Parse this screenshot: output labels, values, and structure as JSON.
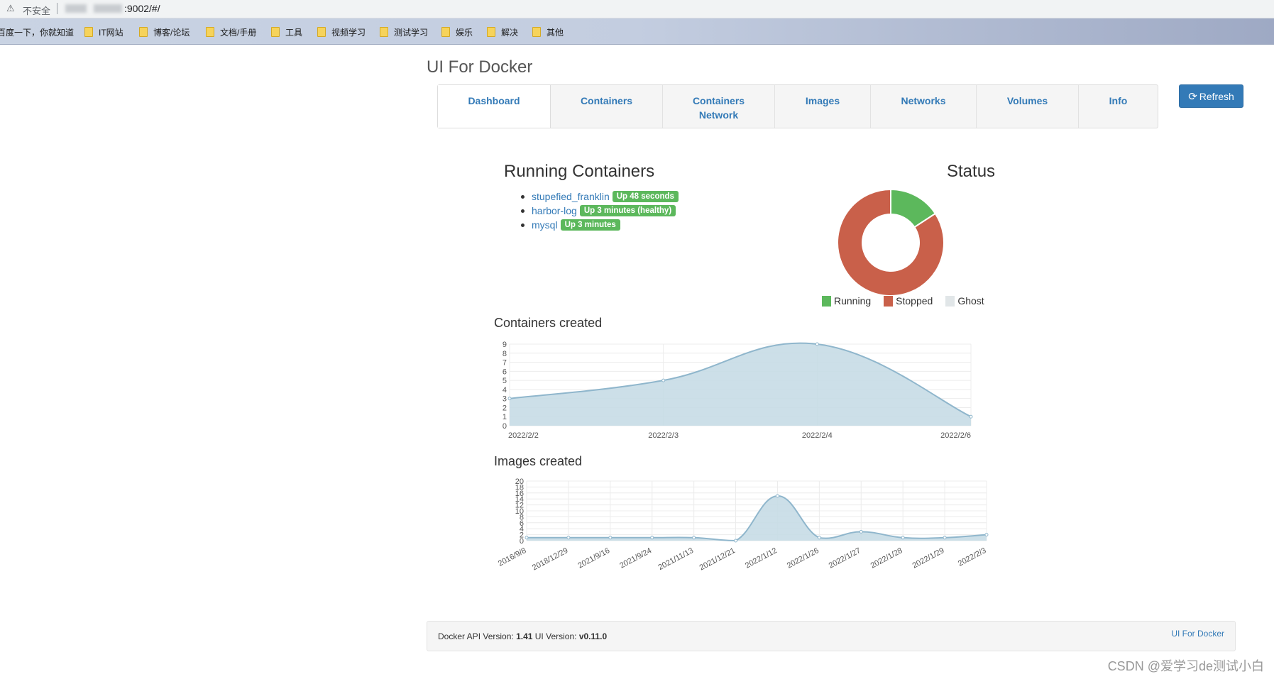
{
  "browser": {
    "security_label": "不安全",
    "url_suffix": ":9002/#/",
    "bookmarks": [
      "百度一下，你就知道",
      "IT网站",
      "博客/论坛",
      "文档/手册",
      "工具",
      "视频学习",
      "测试学习",
      "娱乐",
      "解决",
      "其他"
    ]
  },
  "brand": "UI For Docker",
  "nav": {
    "items": [
      "Dashboard",
      "Containers",
      "Containers Network",
      "Images",
      "Networks",
      "Volumes",
      "Info"
    ],
    "refresh_label": "Refresh"
  },
  "running": {
    "title": "Running Containers",
    "containers": [
      {
        "name": "stupefied_franklin",
        "status": "Up 48 seconds"
      },
      {
        "name": "harbor-log",
        "status": "Up 3 minutes (healthy)"
      },
      {
        "name": "mysql",
        "status": "Up 3 minutes"
      }
    ]
  },
  "status": {
    "title": "Status",
    "legend": [
      "Running",
      "Stopped",
      "Ghost"
    ]
  },
  "colors": {
    "running": "#5cb85c",
    "stopped": "#c9604a",
    "ghost": "#e1e6e8",
    "area_fill": "#c6dbe6",
    "area_stroke": "#8fb6cc",
    "link": "#337ab7"
  },
  "chart_titles": {
    "containers_created": "Containers created",
    "images_created": "Images created"
  },
  "chart_data": [
    {
      "type": "pie",
      "variant": "doughnut",
      "categories": [
        "Running",
        "Stopped",
        "Ghost"
      ],
      "values": [
        3,
        16,
        0
      ]
    },
    {
      "type": "area",
      "title": "Containers created",
      "x": [
        "2022/2/2",
        "2022/2/3",
        "2022/2/4",
        "2022/2/6"
      ],
      "values": [
        3,
        5,
        9,
        1
      ],
      "ylim": [
        0,
        9
      ],
      "yticks": [
        0,
        1,
        2,
        3,
        4,
        5,
        6,
        7,
        8,
        9
      ],
      "grid": true
    },
    {
      "type": "area",
      "title": "Images created",
      "x": [
        "2016/9/8",
        "2018/12/29",
        "2021/9/16",
        "2021/9/24",
        "2021/11/13",
        "2021/12/21",
        "2022/1/12",
        "2022/1/26",
        "2022/1/27",
        "2022/1/28",
        "2022/1/29",
        "2022/2/3"
      ],
      "values": [
        1,
        1,
        1,
        1,
        1,
        0,
        15,
        1,
        3,
        1,
        1,
        2
      ],
      "ylim": [
        0,
        20
      ],
      "yticks": [
        0,
        2,
        4,
        6,
        8,
        10,
        12,
        14,
        16,
        18,
        20
      ],
      "grid": true
    }
  ],
  "footer": {
    "api_label": "Docker API Version:",
    "api_version": "1.41",
    "ui_label": "UI Version:",
    "ui_version": "v0.11.0",
    "link": "UI For Docker"
  },
  "watermark": "CSDN @爱学习de测试小白"
}
